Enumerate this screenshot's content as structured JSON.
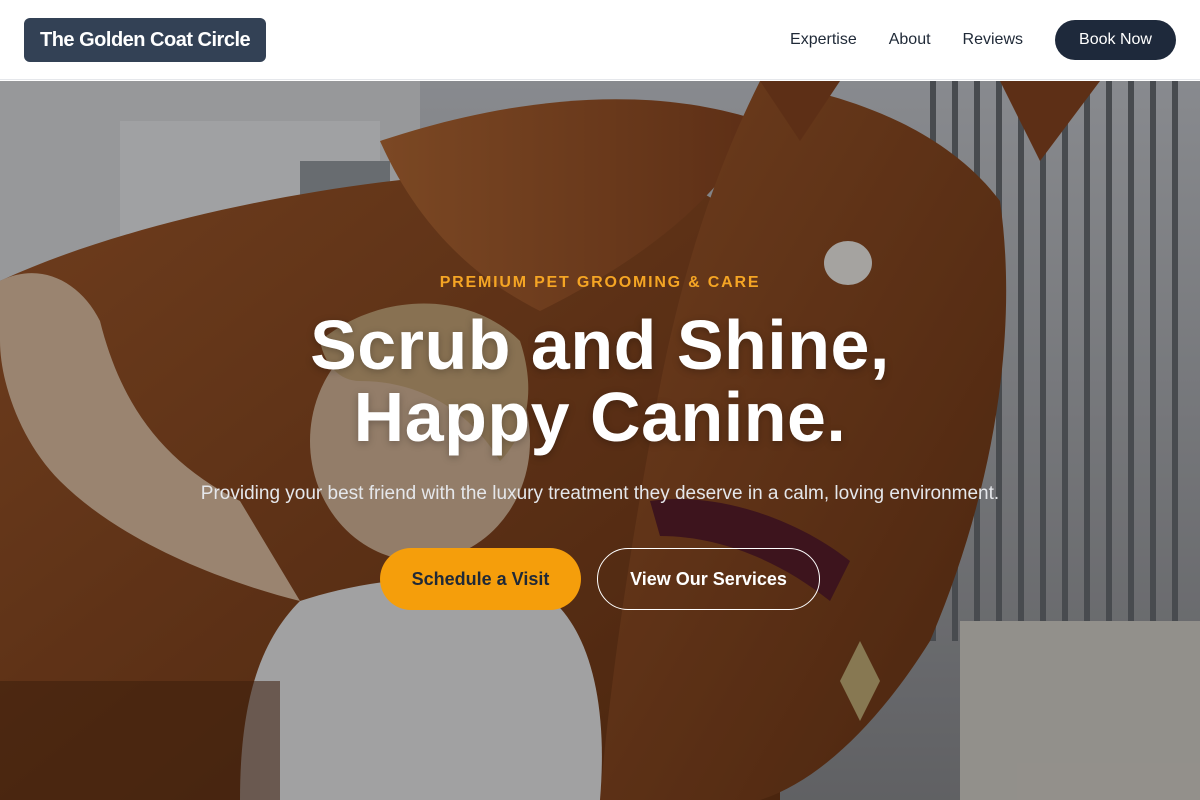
{
  "nav": {
    "brand": "The Golden Coat Circle",
    "links": [
      "Expertise",
      "About",
      "Reviews"
    ],
    "book_label": "Book Now"
  },
  "hero": {
    "eyebrow": "PREMIUM PET GROOMING & CARE",
    "headline_line1": "Scrub and Shine,",
    "headline_line2": "Happy Canine.",
    "subtitle": "Providing your best friend with the luxury treatment they deserve in a calm, loving environment.",
    "primary_cta": "Schedule a Visit",
    "secondary_cta": "View Our Services",
    "background_image": "horse-with-groomer-photo"
  },
  "colors": {
    "accent": "#f59e0b",
    "brand_dark": "#334155",
    "button_dark": "#1e293b"
  }
}
